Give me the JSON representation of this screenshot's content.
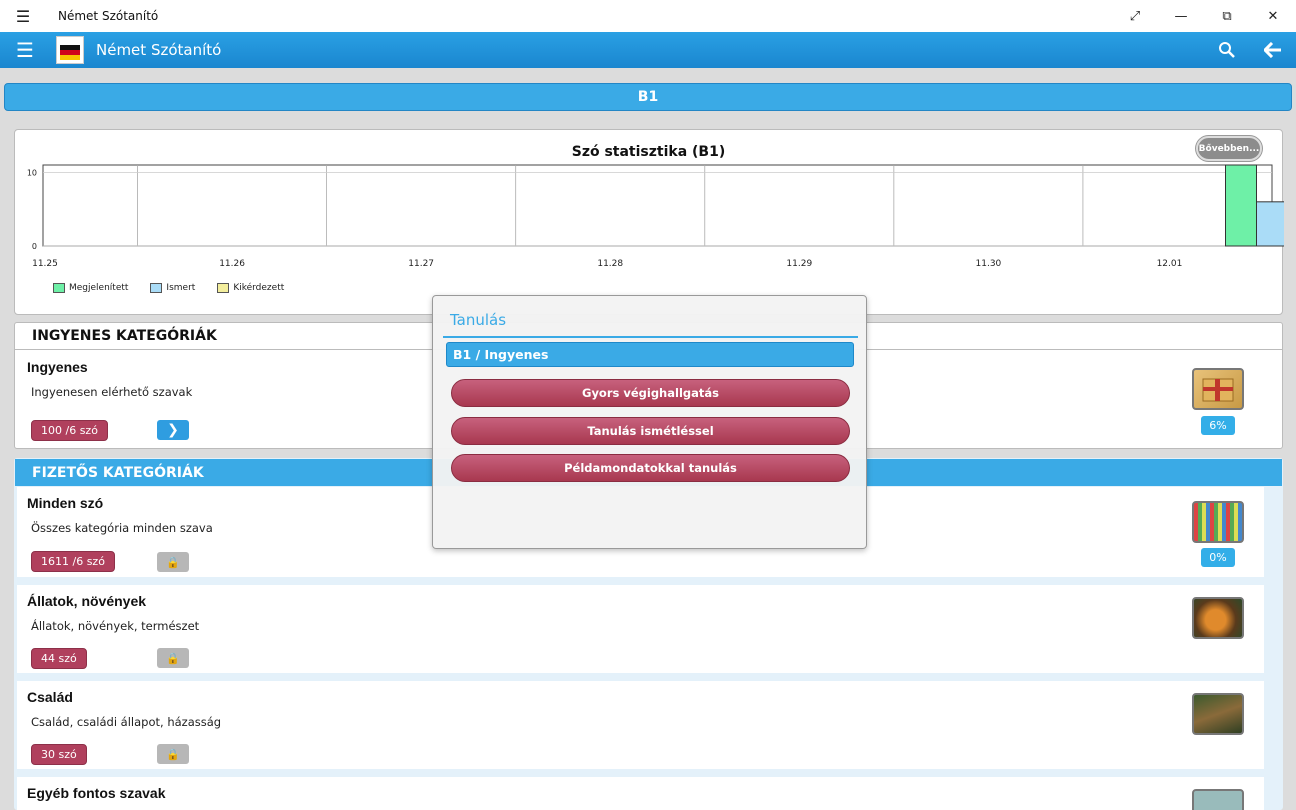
{
  "window": {
    "title": "Német Szótanító"
  },
  "appbar": {
    "title": "Német Szótanító"
  },
  "level": {
    "label": "B1"
  },
  "chart": {
    "more_label": "Bővebben..."
  },
  "chart_data": {
    "type": "bar",
    "title": "Szó statisztika (B1)",
    "categories": [
      "11.25",
      "11.26",
      "11.27",
      "11.28",
      "11.29",
      "11.30",
      "12.01"
    ],
    "series": [
      {
        "name": "Megjelenített",
        "values": [
          0,
          0,
          0,
          0,
          0,
          0,
          11
        ],
        "color": "#6ef0a7"
      },
      {
        "name": "Ismert",
        "values": [
          0,
          0,
          0,
          0,
          0,
          0,
          6
        ],
        "color": "#aadcf7"
      },
      {
        "name": "Kikérdezett",
        "values": [
          0,
          0,
          0,
          0,
          0,
          0,
          0
        ],
        "color": "#f3ee9d"
      }
    ],
    "ylim": [
      0,
      11
    ],
    "yticks": [
      0,
      10
    ],
    "grid": true,
    "legend": "bottom-left"
  },
  "free_section": {
    "header": "INGYENES KATEGÓRIÁK",
    "items": [
      {
        "title": "Ingyenes",
        "desc": "Ingyenesen elérhető szavak",
        "count": "100 /6 szó",
        "percent": "6%",
        "go_icon": "chevron-right-icon"
      }
    ]
  },
  "paid_section": {
    "header": "FIZETŐS KATEGÓRIÁK",
    "items": [
      {
        "title": "Minden szó",
        "desc": "Összes kategória minden szava",
        "count": "1611 /6 szó",
        "percent": "0%",
        "lock_icon": "lock-icon"
      },
      {
        "title": "Állatok, növények",
        "desc": "Állatok, növények, természet",
        "count": "44 szó",
        "lock_icon": "lock-icon"
      },
      {
        "title": "Család",
        "desc": "Család, családi állapot, házasság",
        "count": "30 szó",
        "lock_icon": "lock-icon"
      },
      {
        "title": "Egyéb fontos szavak"
      }
    ]
  },
  "modal": {
    "title": "Tanulás",
    "subtitle": "B1 / Ingyenes",
    "buttons": [
      "Gyors végighallgatás",
      "Tanulás ismétléssel",
      "Példamondatokkal tanulás"
    ]
  }
}
